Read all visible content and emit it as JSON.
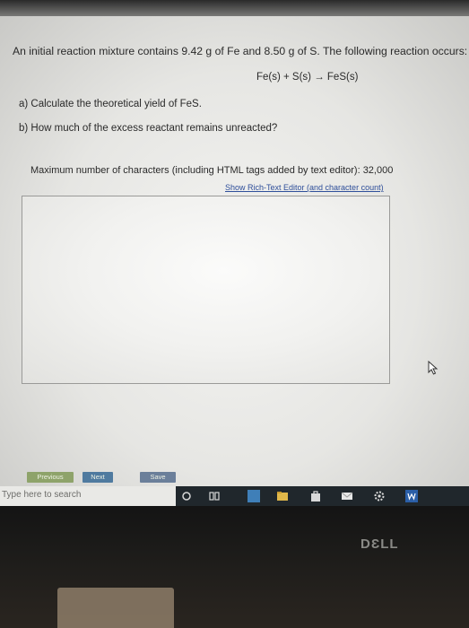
{
  "question": {
    "intro": "An initial reaction mixture contains 9.42 g of Fe and 8.50 g of S. The following reaction occurs:",
    "equation": "Fe(s) + S(s) → FeS(s)",
    "part_a": "a) Calculate the theoretical yield of FeS.",
    "part_b": "b) How much of the excess reactant remains unreacted?"
  },
  "editor": {
    "max_chars_label": "Maximum number of characters (including HTML tags added by text editor): 32,000",
    "rich_text_link": "Show Rich-Text Editor (and character count)",
    "value": ""
  },
  "buttons": {
    "previous": "Previous",
    "next": "Next",
    "save": "Save"
  },
  "taskbar": {
    "search_placeholder": "Type here to search",
    "icons": [
      "cortana-icon",
      "task-view-icon",
      "app-icon",
      "file-explorer-icon",
      "store-icon",
      "mail-icon",
      "settings-icon",
      "word-icon"
    ]
  },
  "bezel": {
    "brand": "DƐLL"
  },
  "colors": {
    "previous_button": "#8ea36a",
    "next_button": "#4f7a9f",
    "save_button": "#6b7f9a",
    "taskbar": "#20272c",
    "link": "#2f4f9a"
  }
}
